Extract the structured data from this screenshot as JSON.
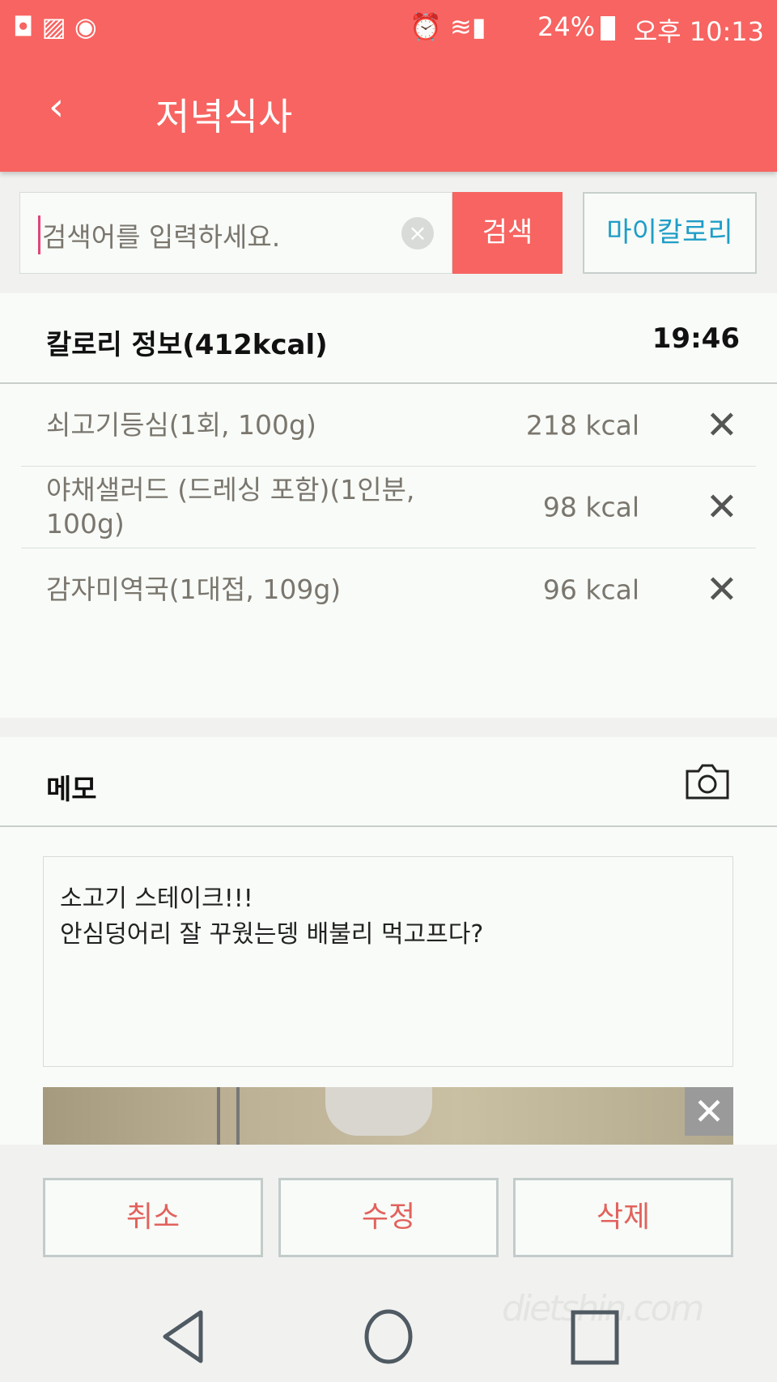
{
  "status_bar": {
    "battery": "24%",
    "time": "오후 10:13",
    "icons": [
      "uplus-icon",
      "gallery-icon",
      "toggle-icon",
      "alarm-icon",
      "wifi-icon",
      "signal-icon",
      "battery-icon"
    ]
  },
  "header": {
    "title": "저녁식사",
    "back_icon": "chevron-left-icon"
  },
  "search": {
    "placeholder": "검색어를 입력하세요.",
    "button": "검색",
    "my_calorie": "마이칼로리"
  },
  "calorie": {
    "title": "칼로리 정보(412kcal)",
    "time": "19:46",
    "items": [
      {
        "name": "쇠고기등심(1회, 100g)",
        "kcal": "218 kcal"
      },
      {
        "name": "야채샐러드 (드레싱 포함)(1인분, 100g)",
        "kcal": "98 kcal"
      },
      {
        "name": "감자미역국(1대접, 109g)",
        "kcal": "96 kcal"
      }
    ]
  },
  "memo": {
    "title": "메모",
    "text": "소고기 스테이크!!!\n안심덩어리 잘 꾸웠는뎅 배불리 먹고프다?"
  },
  "actions": {
    "cancel": "취소",
    "edit": "수정",
    "delete": "삭제"
  },
  "watermark": "dietshin.com",
  "colors": {
    "accent": "#f76461",
    "link": "#1f9dc8",
    "action_text": "#e2625d"
  }
}
